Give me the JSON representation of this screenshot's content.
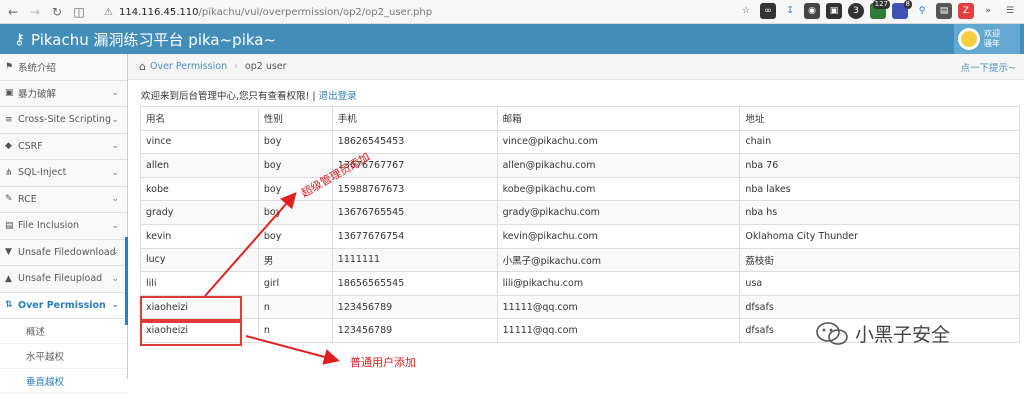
{
  "browser": {
    "url_host": "114.116.45.110",
    "url_path": "/pikachu/vul/overpermission/op2/op2_user.php",
    "extension_badges": [
      "127",
      "8"
    ]
  },
  "header": {
    "title": "Pikachu 漏洞练习平台 pika~pika~",
    "user_line1": "欢迎",
    "user_line2": "骚年"
  },
  "sidebar": {
    "items": [
      {
        "icon": "tags-icon",
        "label": "系统介绍",
        "chevron": false
      },
      {
        "icon": "lock-icon",
        "label": "暴力破解",
        "chevron": true
      },
      {
        "icon": "list-icon",
        "label": "Cross-Site Scripting",
        "chevron": true
      },
      {
        "icon": "tag-icon",
        "label": "CSRF",
        "chevron": true
      },
      {
        "icon": "fork-icon",
        "label": "SQL-Inject",
        "chevron": true
      },
      {
        "icon": "pencil-icon",
        "label": "RCE",
        "chevron": true
      },
      {
        "icon": "file-icon",
        "label": "File Inclusion",
        "chevron": true
      },
      {
        "icon": "download-icon",
        "label": "Unsafe Filedownload",
        "chevron": true
      },
      {
        "icon": "upload-icon",
        "label": "Unsafe Fileupload",
        "chevron": true
      },
      {
        "icon": "sort-icon",
        "label": "Over Permission",
        "chevron": true,
        "active": true
      }
    ],
    "subitems": [
      {
        "label": "概述"
      },
      {
        "label": "水平越权"
      },
      {
        "label": "垂直越权",
        "current": true
      }
    ]
  },
  "breadcrumb": {
    "parent": "Over Permission",
    "current": "op2 user",
    "hint": "点一下提示~"
  },
  "main": {
    "welcome_text": "欢迎来到后台管理中心,您只有查看权限! |",
    "logout_label": "退出登录",
    "columns": [
      "用名",
      "性别",
      "手机",
      "邮箱",
      "地址"
    ],
    "rows": [
      [
        "vince",
        "boy",
        "18626545453",
        "vince@pikachu.com",
        "chain"
      ],
      [
        "allen",
        "boy",
        "13676767767",
        "allen@pikachu.com",
        "nba 76"
      ],
      [
        "kobe",
        "boy",
        "15988767673",
        "kobe@pikachu.com",
        "nba lakes"
      ],
      [
        "grady",
        "boy",
        "13676765545",
        "grady@pikachu.com",
        "nba hs"
      ],
      [
        "kevin",
        "boy",
        "13677676754",
        "kevin@pikachu.com",
        "Oklahoma City Thunder"
      ],
      [
        "lucy",
        "男",
        "1111111",
        "小黑子@pikachu.com",
        "荔枝街"
      ],
      [
        "lili",
        "girl",
        "18656565545",
        "lili@pikachu.com",
        "usa"
      ],
      [
        "xiaoheizi",
        "n",
        "123456789",
        "11111@qq.com",
        "dfsafs"
      ],
      [
        "xiaoheizi",
        "n",
        "123456789",
        "11111@qq.com",
        "dfsafs"
      ]
    ]
  },
  "annotations": {
    "admin_added": "超级管理员添加",
    "user_added": "普通用户添加",
    "color": "#e02020"
  },
  "watermark": "小黑子安全"
}
